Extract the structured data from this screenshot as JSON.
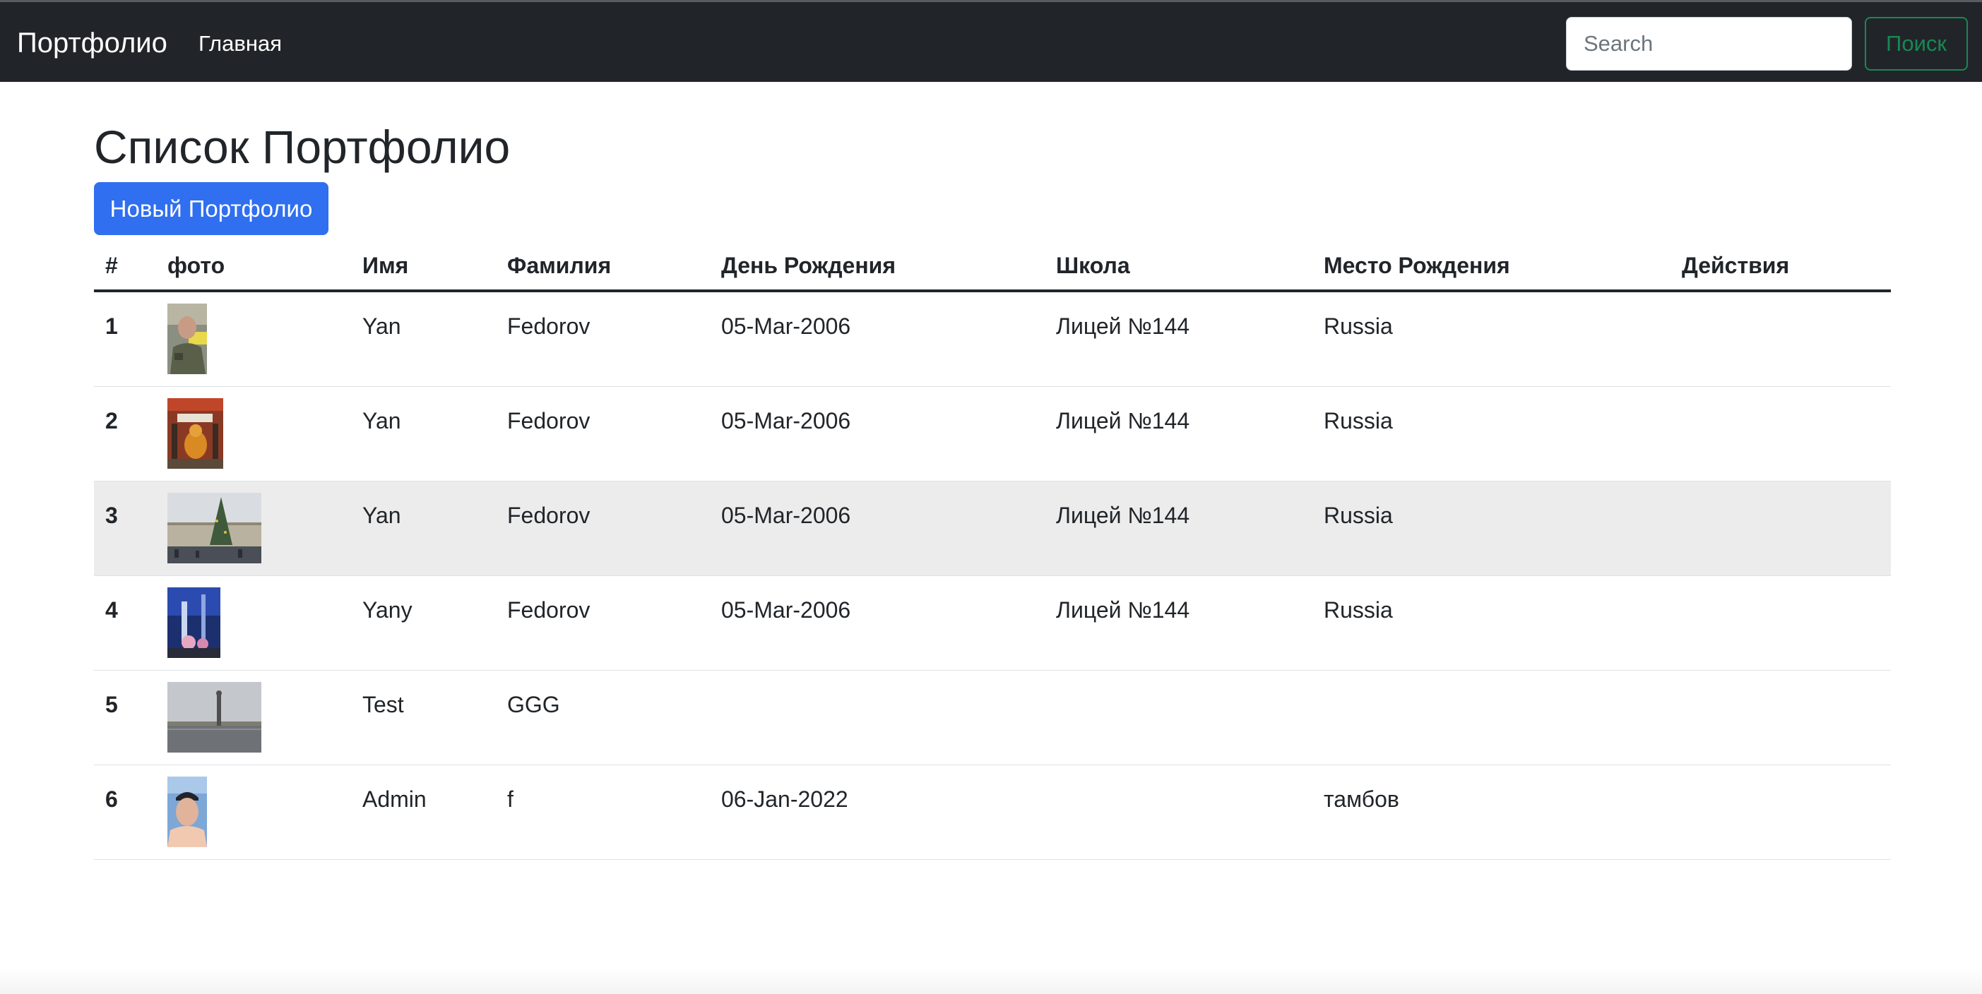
{
  "navbar": {
    "brand": "Портфолио",
    "nav_items": [
      {
        "label": "Главная"
      }
    ],
    "search": {
      "placeholder": "Search",
      "value": ""
    },
    "search_button": "Поиск"
  },
  "main": {
    "title": "Список Портфолио",
    "new_button": "Новый Портфолио",
    "table": {
      "headers": [
        "#",
        "фото",
        "Имя",
        "Фамилия",
        "День Рождения",
        "Школа",
        "Место Рождения",
        "Действия"
      ],
      "rows": [
        {
          "num": "1",
          "first_name": "Yan",
          "last_name": "Fedorov",
          "birthday": "05-Mar-2006",
          "school": "Лицей №144",
          "birthplace": "Russia",
          "photo": "portrait-photo"
        },
        {
          "num": "2",
          "first_name": "Yan",
          "last_name": "Fedorov",
          "birthday": "05-Mar-2006",
          "school": "Лицей №144",
          "birthplace": "Russia",
          "photo": "poster-photo"
        },
        {
          "num": "3",
          "first_name": "Yan",
          "last_name": "Fedorov",
          "birthday": "05-Mar-2006",
          "school": "Лицей №144",
          "birthplace": "Russia",
          "photo": "christmas-tree-square-photo"
        },
        {
          "num": "4",
          "first_name": "Yany",
          "last_name": "Fedorov",
          "birthday": "05-Mar-2006",
          "school": "Лицей №144",
          "birthplace": "Russia",
          "photo": "night-city-photo"
        },
        {
          "num": "5",
          "first_name": "Test",
          "last_name": "GGG",
          "birthday": "",
          "school": "",
          "birthplace": "",
          "photo": "palace-square-photo"
        },
        {
          "num": "6",
          "first_name": "Admin",
          "last_name": "f",
          "birthday": "06-Jan-2022",
          "school": "",
          "birthplace": "тамбов",
          "photo": "selfie-photo"
        }
      ]
    }
  },
  "colors": {
    "navbar_bg": "#212529",
    "primary": "#2f6ff0",
    "success": "#198754",
    "row_hover": "#ececec"
  }
}
